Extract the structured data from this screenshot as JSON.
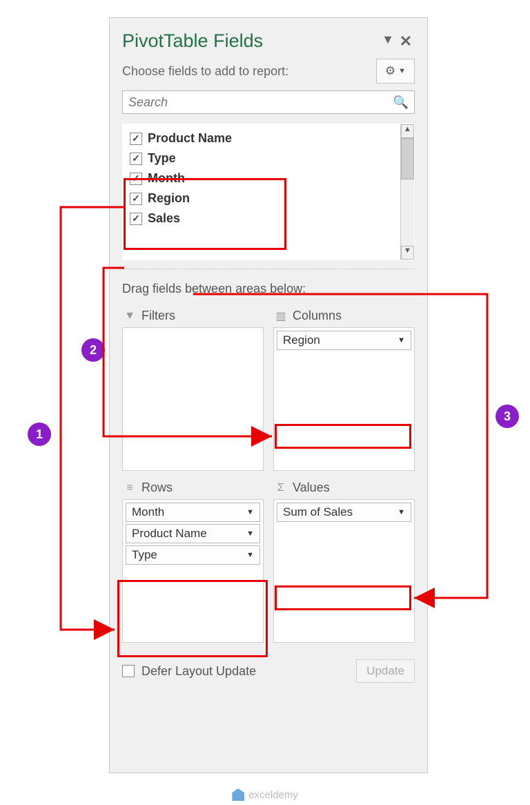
{
  "header": {
    "title": "PivotTable Fields",
    "subtitle": "Choose fields to add to report:",
    "search_placeholder": "Search"
  },
  "fields": [
    {
      "label": "Product Name",
      "checked": true
    },
    {
      "label": "Type",
      "checked": true
    },
    {
      "label": "Month",
      "checked": true
    },
    {
      "label": "Region",
      "checked": true
    },
    {
      "label": "Sales",
      "checked": true
    }
  ],
  "drag_label": "Drag fields between areas below:",
  "areas": {
    "filters": {
      "title": "Filters",
      "items": []
    },
    "columns": {
      "title": "Columns",
      "items": [
        "Region"
      ]
    },
    "rows": {
      "title": "Rows",
      "items": [
        "Month",
        "Product Name",
        "Type"
      ]
    },
    "values": {
      "title": "Values",
      "items": [
        "Sum of Sales"
      ]
    }
  },
  "footer": {
    "defer_label": "Defer Layout Update",
    "update_label": "Update"
  },
  "badges": {
    "b1": "1",
    "b2": "2",
    "b3": "3"
  },
  "watermark": "exceldemy"
}
